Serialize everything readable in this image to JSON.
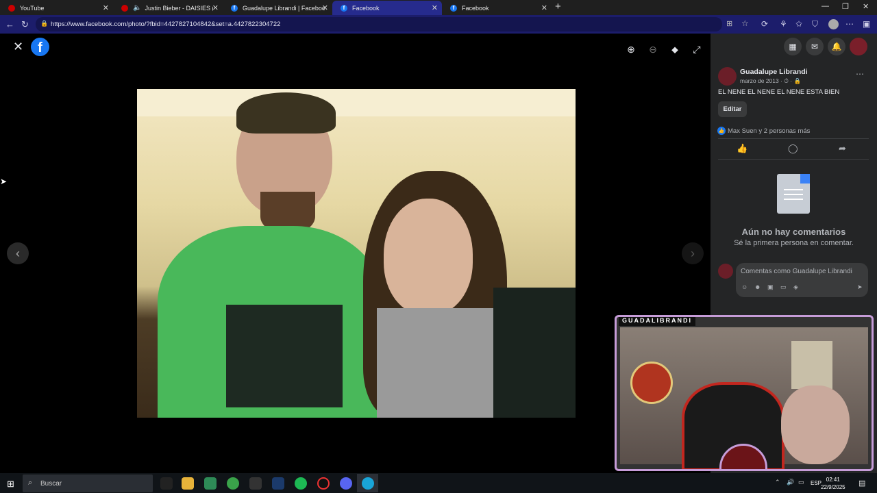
{
  "browser": {
    "tabs": [
      {
        "title": "YouTube",
        "icon": "youtube-icon",
        "active": false
      },
      {
        "title": "Justin Bieber - DAISIES (Audi",
        "icon": "youtube-icon",
        "active": false
      },
      {
        "title": "Guadalupe Librandi | Facebook",
        "icon": "facebook-icon",
        "active": false
      },
      {
        "title": "Facebook",
        "icon": "facebook-icon",
        "active": true
      },
      {
        "title": "Facebook",
        "icon": "facebook-icon",
        "active": false
      }
    ],
    "url": "https://www.facebook.com/photo/?fbid=4427827104842&set=a.4427822304722"
  },
  "post": {
    "author": "Guadalupe Librandi",
    "date": "marzo de 2013",
    "caption": "EL NENE EL NENE EL NENE ESTA BIEN",
    "edit_label": "Editar",
    "reactions": "Max Suen y 2 personas más",
    "no_comments_title": "Aún no hay comentarios",
    "no_comments_sub": "Sé la primera persona en comentar.",
    "comment_placeholder": "Comentas como Guadalupe Librandi"
  },
  "stream": {
    "label": "GUADALIBRANDI"
  },
  "taskbar": {
    "search_placeholder": "Buscar",
    "lang": "ESP",
    "time": "02:41",
    "date": "22/9/2025"
  },
  "colors": {
    "facebook_blue": "#1877f2",
    "panel_bg": "#242526",
    "active_tab": "#262b8d"
  }
}
